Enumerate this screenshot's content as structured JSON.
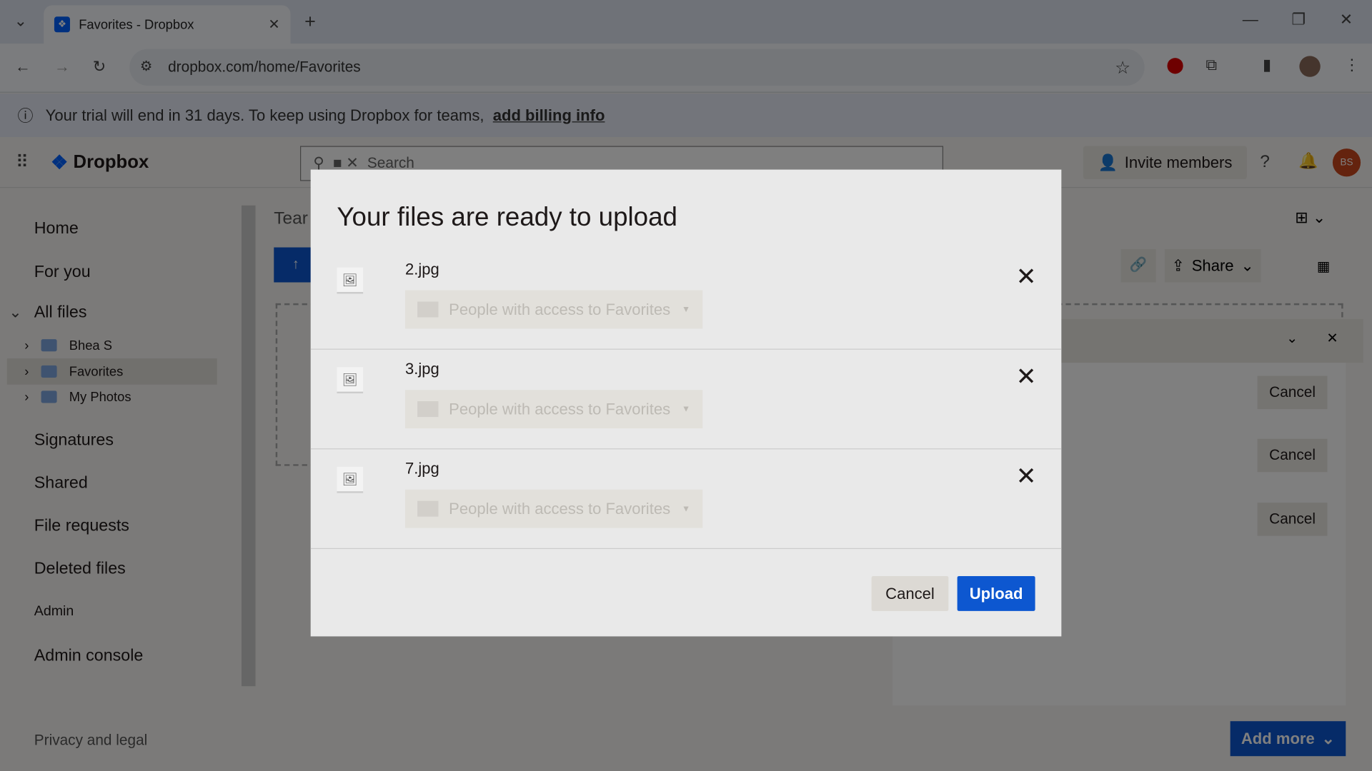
{
  "browser": {
    "tab_title": "Favorites - Dropbox",
    "url": "dropbox.com/home/Favorites"
  },
  "banner": {
    "text": "Your trial will end in 31 days. To keep using Dropbox for teams,",
    "link": "add billing info"
  },
  "app": {
    "logo": "Dropbox",
    "search_placeholder": "Search",
    "invite_label": "Invite members",
    "avatar_initials": "BS"
  },
  "sidebar": {
    "items": [
      "Home",
      "For you",
      "All files",
      "Signatures",
      "Shared",
      "File requests",
      "Deleted files",
      "Admin",
      "Admin console",
      "Privacy and legal"
    ],
    "tree": [
      "Bhea S",
      "Favorites",
      "My Photos"
    ]
  },
  "main": {
    "title_partial": "Tear",
    "share_label": "Share",
    "panel_partial": "s",
    "row_cancel": "Cancel",
    "add_more": "Add more"
  },
  "modal": {
    "title": "Your files are ready to upload",
    "files": [
      {
        "name": "2.jpg",
        "destination": "People with access to Favorites"
      },
      {
        "name": "3.jpg",
        "destination": "People with access to Favorites"
      },
      {
        "name": "7.jpg",
        "destination": "People with access to Favorites"
      }
    ],
    "cancel_label": "Cancel",
    "upload_label": "Upload"
  },
  "colors": {
    "primary": "#0d57d0",
    "brand": "#0061fe"
  }
}
